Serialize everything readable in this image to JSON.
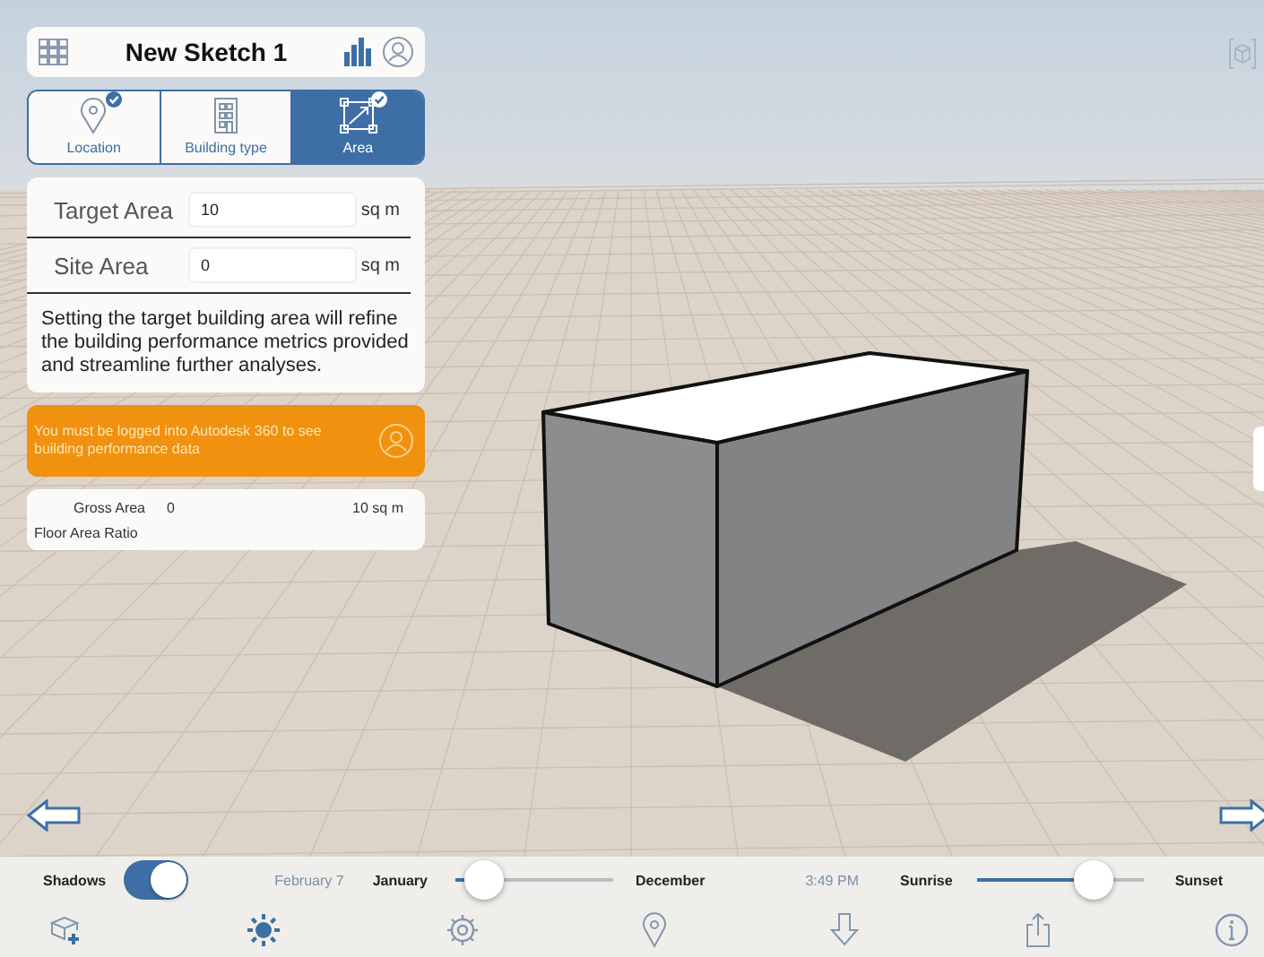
{
  "header": {
    "title": "New Sketch 1"
  },
  "tabs": [
    {
      "kind": "location",
      "label": "Location",
      "selected": false,
      "checked": true
    },
    {
      "kind": "building",
      "label": "Building type",
      "selected": false,
      "checked": false
    },
    {
      "kind": "area",
      "label": "Area",
      "selected": true,
      "checked": true
    }
  ],
  "area_form": {
    "fields": [
      {
        "label": "Target Area",
        "value": "10",
        "unit": "sq m"
      },
      {
        "label": "Site Area",
        "value": "0",
        "unit": "sq m"
      }
    ],
    "note": "Setting the target building area will refine the building performance metrics provided and streamline further analyses."
  },
  "login_banner": {
    "message": "You must be logged into Autodesk 360 to see building performance data"
  },
  "metrics": {
    "gross_area": {
      "label": "Gross Area",
      "value": "0",
      "total": "10 sq m"
    },
    "floor_area_ratio": {
      "label": "Floor Area Ratio"
    }
  },
  "time_bar": {
    "shadows": {
      "label": "Shadows",
      "on": true
    },
    "date": {
      "value": "February 7",
      "start": "January",
      "end": "December",
      "level": 0.19
    },
    "time": {
      "value": "3:49 PM",
      "start": "Sunrise",
      "end": "Sunset",
      "level": 0.7
    }
  }
}
